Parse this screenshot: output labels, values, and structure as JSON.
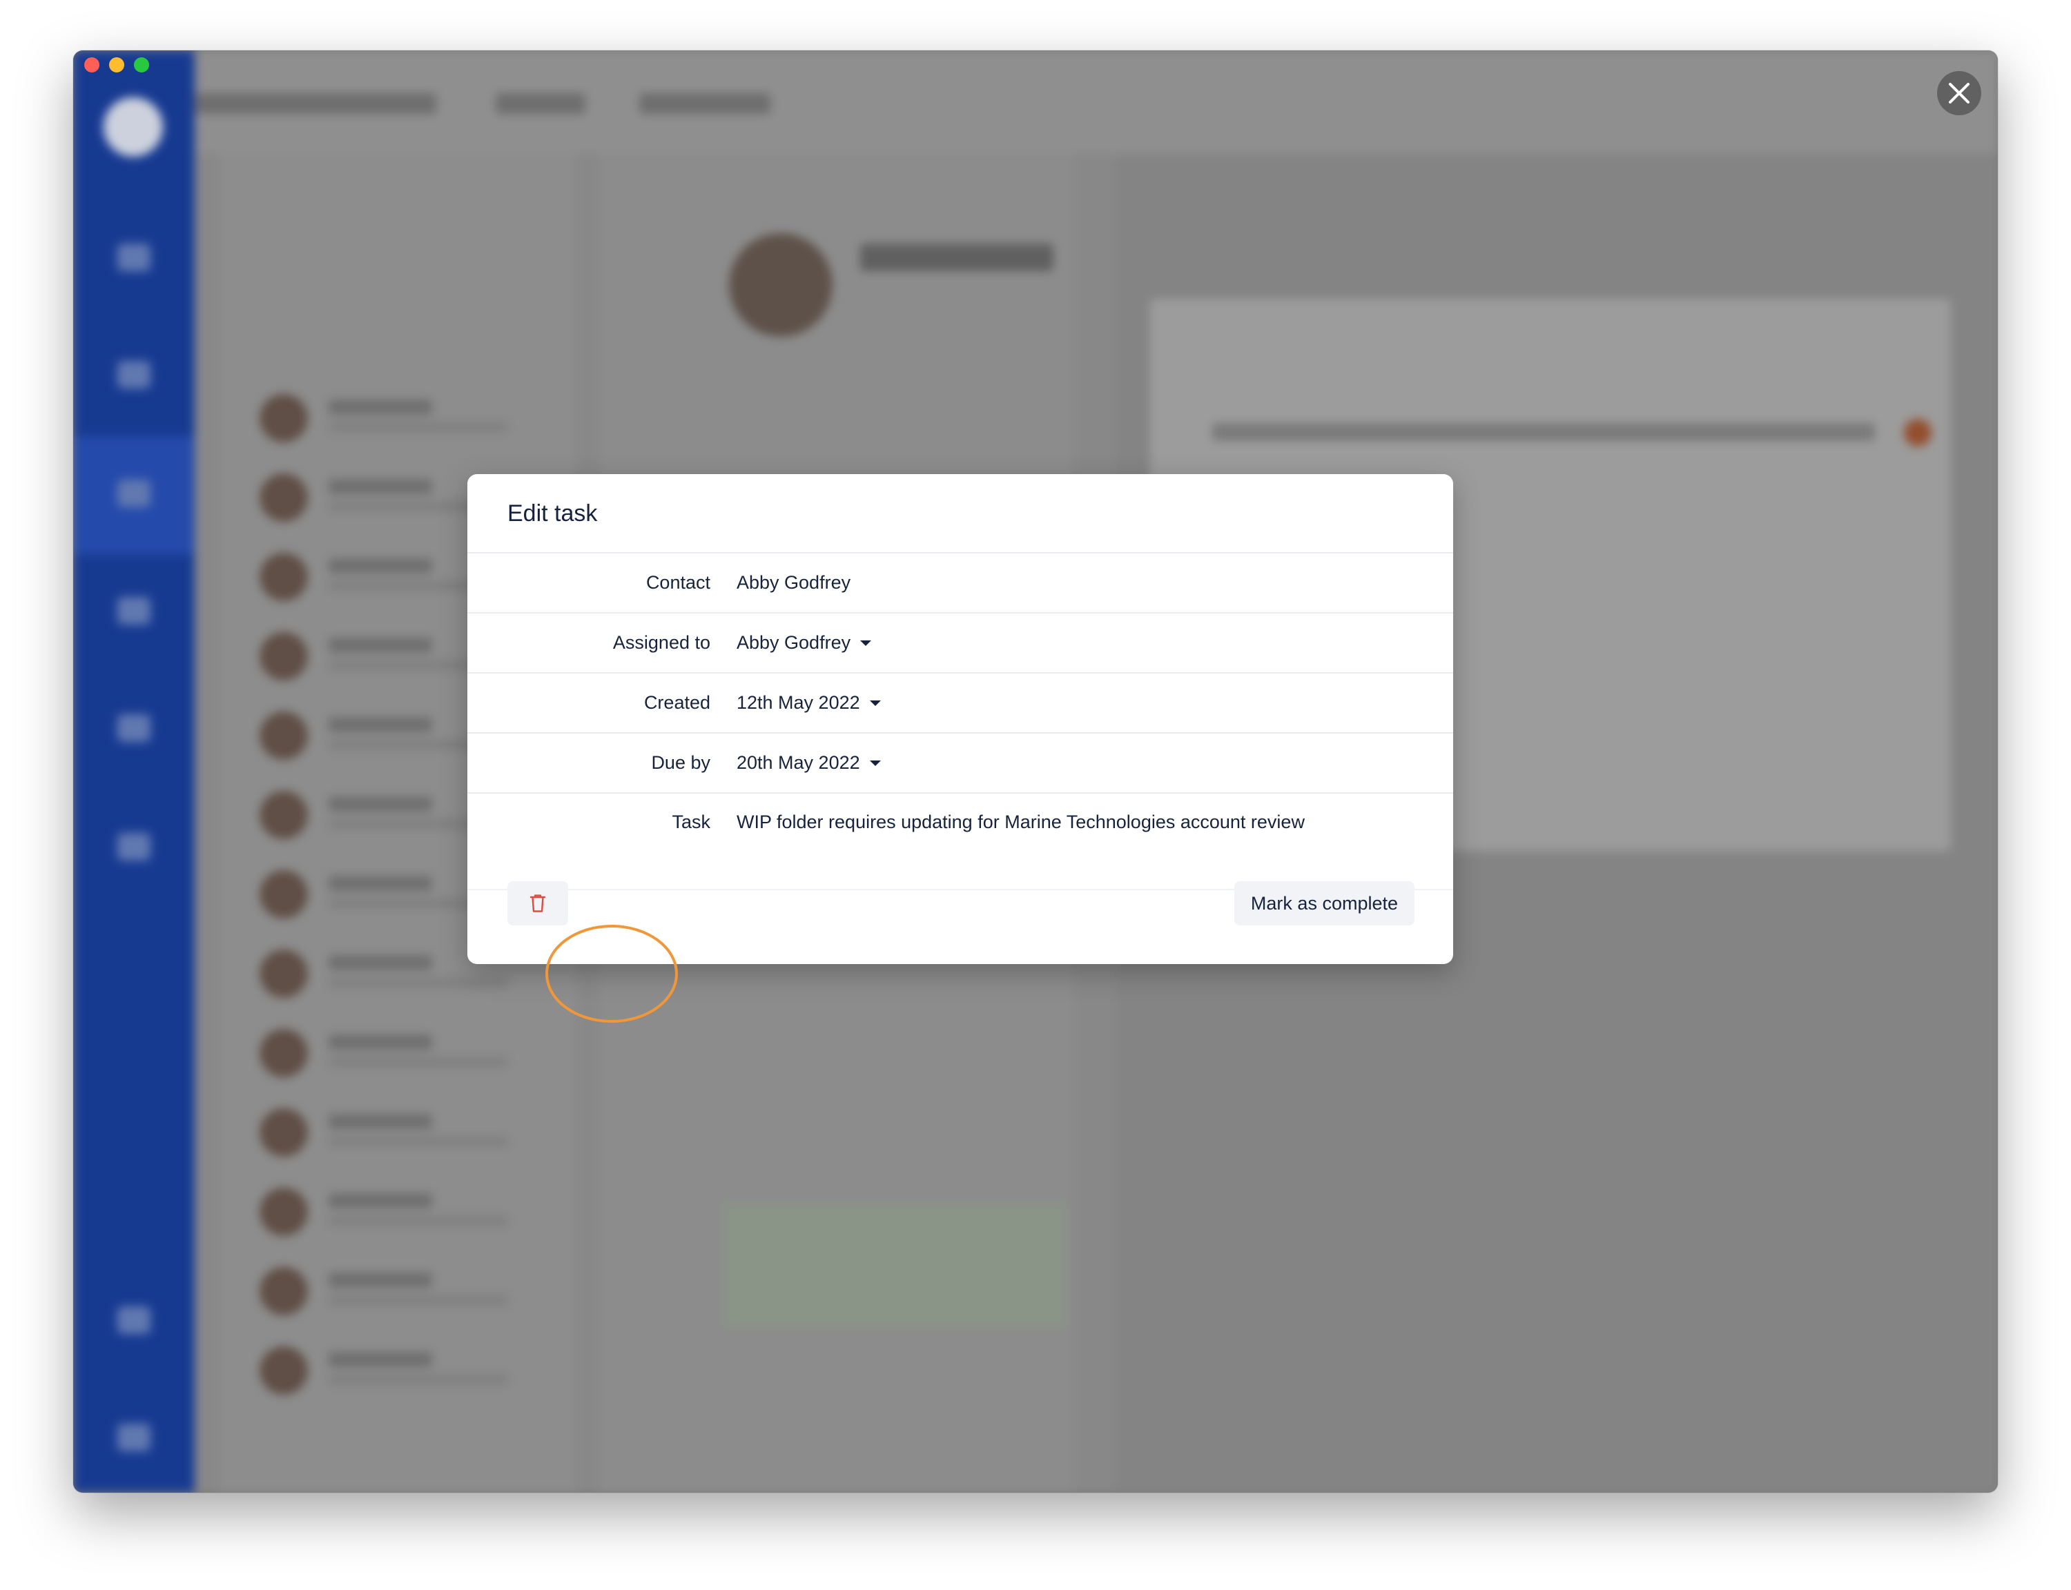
{
  "window": {
    "traffic_lights": {
      "close": "#ff5f57",
      "minimize": "#febc2e",
      "zoom": "#28c840"
    },
    "close_overlay_icon": "close-icon"
  },
  "background_app": {
    "sidebar_color": "#1b43a6",
    "state": "blurred behind modal"
  },
  "modal": {
    "title": "Edit task",
    "fields": [
      {
        "label": "Contact",
        "value": "Abby Godfrey",
        "dropdown": false
      },
      {
        "label": "Assigned to",
        "value": "Abby Godfrey",
        "dropdown": true
      },
      {
        "label": "Created",
        "value": "12th May 2022",
        "dropdown": true
      },
      {
        "label": "Due by",
        "value": "20th May 2022",
        "dropdown": true
      },
      {
        "label": "Task",
        "value": "WIP folder requires updating for Marine Technologies account review",
        "dropdown": false
      }
    ],
    "footer": {
      "delete_icon": "trash-icon",
      "delete_color": "#e04a3f",
      "complete_label": "Mark as complete"
    }
  },
  "annotation": {
    "ring_color": "#f0973a",
    "target": "delete-task-button"
  }
}
